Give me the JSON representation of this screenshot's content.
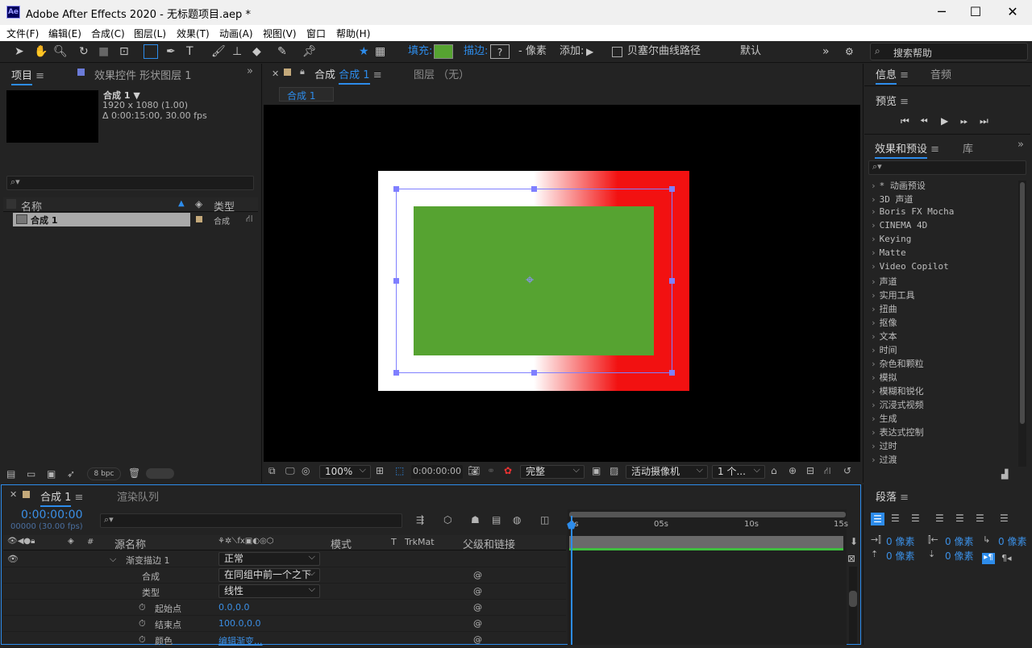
{
  "window": {
    "app_badge": "Ae",
    "title": "Adobe After Effects 2020 - 无标题项目.aep *",
    "minimize": "─",
    "maximize": "☐",
    "close": "✕"
  },
  "menu": [
    "文件(F)",
    "编辑(E)",
    "合成(C)",
    "图层(L)",
    "效果(T)",
    "动画(A)",
    "视图(V)",
    "窗口",
    "帮助(H)"
  ],
  "toolbar": {
    "fill_label": "填充:",
    "fill_color": "#56a331",
    "stroke_label": "描边:",
    "stroke_value": "?",
    "px_label": "- 像素",
    "add_label": "添加:",
    "bezier_label": "贝塞尔曲线路径",
    "workspace": "默认",
    "search_placeholder": "搜索帮助"
  },
  "project_panel": {
    "tab_project": "项目",
    "tab_effects": "效果控件 形状图层 1",
    "comp_name": "合成 1 ▼",
    "comp_res": "1920 x 1080 (1.00)",
    "comp_dur": "Δ 0:00:15:00, 30.00 fps",
    "col_name": "名称",
    "col_type": "类型",
    "item_name": "合成 1",
    "item_type": "合成",
    "bpc": "8 bpc"
  },
  "comp_panel": {
    "tab_label": "合成",
    "tab_comp": "合成 1",
    "layer_tab": "图层 （无）",
    "breadcrumb": "合成 1",
    "zoom": "100%",
    "timecode": "0:00:00:00",
    "quality": "完整",
    "camera": "活动摄像机",
    "views": "1 个..."
  },
  "info_panel": {
    "tab_info": "信息",
    "tab_audio": "音频",
    "preview": "预览",
    "effects_tab": "效果和预设",
    "library_tab": "库",
    "effects": [
      "* 动画预设",
      "3D 声道",
      "Boris FX Mocha",
      "CINEMA 4D",
      "Keying",
      "Matte",
      "Video Copilot",
      "声道",
      "实用工具",
      "扭曲",
      "抠像",
      "文本",
      "时间",
      "杂色和颗粒",
      "模拟",
      "模糊和锐化",
      "沉浸式视频",
      "生成",
      "表达式控制",
      "过时",
      "过渡"
    ]
  },
  "timeline": {
    "tab_comp": "合成 1",
    "tab_render": "渲染队列",
    "timecode": "0:00:00:00",
    "frame_info": "00000 (30.00 fps)",
    "col_source": "源名称",
    "col_mode": "模式",
    "col_t": "T",
    "col_trkmat": "TrkMat",
    "col_parent": "父级和链接",
    "col_hash": "#",
    "ruler": [
      "0s",
      "05s",
      "10s",
      "15s"
    ],
    "rows": [
      {
        "name": "渐变描边 1",
        "value": "正常"
      },
      {
        "name": "合成",
        "value": "在同组中前一个之下"
      },
      {
        "name": "类型",
        "value": "线性"
      },
      {
        "name": "起始点",
        "value": "0.0,0.0"
      },
      {
        "name": "结束点",
        "value": "100.0,0.0"
      },
      {
        "name": "颜色",
        "value": "编辑渐变..."
      }
    ]
  },
  "paragraph_panel": {
    "tab": "段落",
    "indent_l": "0 像素",
    "indent_r": "0 像素",
    "indent_f": "0 像素",
    "space_b": "0 像素",
    "space_a": "0 像素"
  }
}
